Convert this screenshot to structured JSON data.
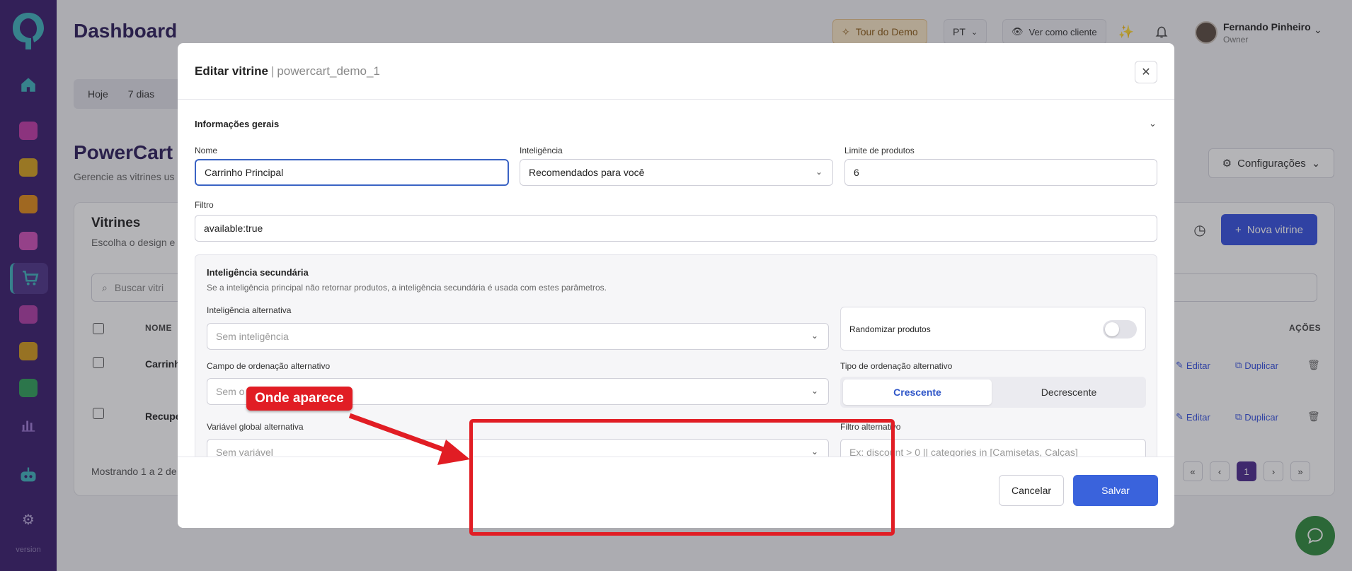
{
  "header": {
    "title": "Dashboard",
    "tour_label": "Tour do Demo",
    "language": "PT",
    "view_as_label": "Ver como cliente",
    "user_name": "Fernando Pinheiro",
    "user_role": "Owner"
  },
  "sidebar": {
    "version": "version"
  },
  "page": {
    "filters": [
      "Hoje",
      "7 dias"
    ],
    "title": "PowerCart",
    "subtitle": "Gerencie as vitrines us",
    "config_label": "Configurações",
    "card_title": "Vitrines",
    "card_subtitle": "Escolha o design e",
    "new_label": "Nova vitrine",
    "search_placeholder": "Buscar vitri",
    "col_name": "NOME",
    "col_actions": "AÇÕES",
    "rows": [
      {
        "name": "Carrinh"
      },
      {
        "name": "Recupe"
      }
    ],
    "edit_label": "Editar",
    "duplicate_label": "Duplicar",
    "showing": "Mostrando 1 a 2 de",
    "current_page": "1"
  },
  "modal": {
    "title": "Editar vitrine",
    "separator": "|",
    "slug": "powercart_demo_1",
    "section_title": "Informações gerais",
    "name_label": "Nome",
    "name_value": "Carrinho Principal",
    "intel_label": "Inteligência",
    "intel_value": "Recomendados para você",
    "limit_label": "Limite de produtos",
    "limit_value": "6",
    "filter_label": "Filtro",
    "filter_value": "available:true",
    "secondary_title": "Inteligência secundária",
    "secondary_desc": "Se a inteligência principal não retornar produtos, a inteligência secundária é usada com estes parâmetros.",
    "alt_intel_label": "Inteligência alternativa",
    "alt_intel_placeholder": "Sem inteligência",
    "randomize_label": "Randomizar produtos",
    "randomize_on": false,
    "alt_sort_field_label": "Campo de ordenação alternativo",
    "alt_sort_field_placeholder": "Sem o",
    "alt_sort_type_label": "Tipo de ordenação alternativo",
    "sort_asc": "Crescente",
    "sort_desc": "Decrescente",
    "alt_global_var_label": "Variável global alternativa",
    "alt_global_var_placeholder": "Sem variável",
    "alt_filter_label": "Filtro alternativo",
    "alt_filter_placeholder": "Ex: discount > 0 || categories in [Camisetas, Calças]",
    "cancel_label": "Cancelar",
    "save_label": "Salvar"
  },
  "annotation": {
    "label": "Onde aparece"
  },
  "colors": {
    "sidebar": "#3a1d6e",
    "primary": "#3a63dc",
    "annotation": "#e11d24"
  }
}
